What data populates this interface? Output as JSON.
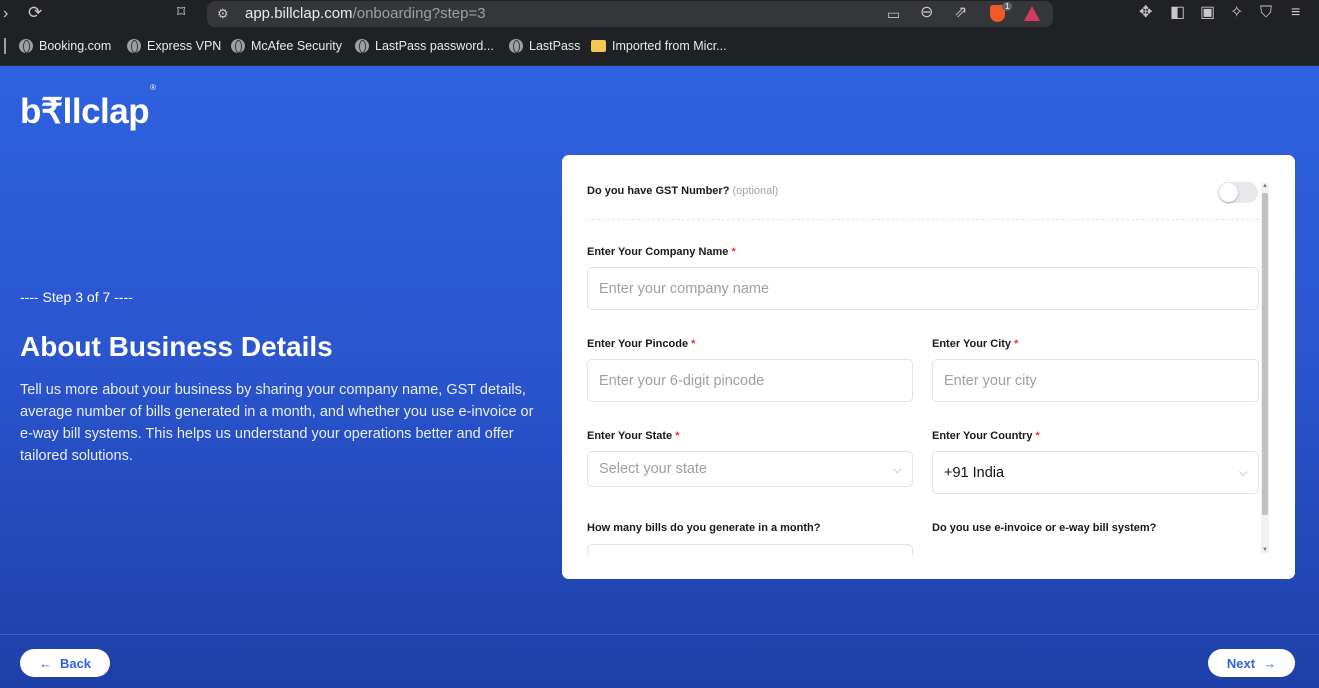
{
  "browser": {
    "url_host": "app.billclap.com",
    "url_path": "/onboarding?step=3",
    "bookmarks": [
      {
        "label": "Booking.com",
        "icon": "globe-icon"
      },
      {
        "label": "Express VPN",
        "icon": "globe-icon"
      },
      {
        "label": "McAfee Security",
        "icon": "globe-icon"
      },
      {
        "label": "LastPass password...",
        "icon": "globe-icon"
      },
      {
        "label": "LastPass",
        "icon": "globe-icon"
      },
      {
        "label": "Imported from Micr...",
        "icon": "folder-icon"
      }
    ],
    "shield_badge": "1"
  },
  "brand": {
    "logo_text": "b₹llclap",
    "registered": "®"
  },
  "left": {
    "step": "---- Step 3 of 7 ----",
    "title": "About Business Details",
    "description": "Tell us more about your business by sharing your company name, GST details, average number of bills generated in a month, and whether you use e-invoice or e-way bill systems. This helps us understand your operations better and offer tailored solutions."
  },
  "form": {
    "gst": {
      "label": "Do you have GST Number?",
      "optional": "(optional)",
      "enabled": false
    },
    "company": {
      "label": "Enter Your Company Name",
      "required": "*",
      "placeholder": "Enter your company name",
      "value": ""
    },
    "pincode": {
      "label": "Enter Your Pincode",
      "required": "*",
      "placeholder": "Enter your 6-digit pincode",
      "value": ""
    },
    "city": {
      "label": "Enter Your City",
      "required": "*",
      "placeholder": "Enter your city",
      "value": ""
    },
    "state": {
      "label": "Enter Your State",
      "required": "*",
      "placeholder": "Select your state"
    },
    "country": {
      "label": "Enter Your Country",
      "required": "*",
      "value": "+91 India"
    },
    "bills": {
      "label": "How many bills do you generate in a month?"
    },
    "einvoice": {
      "label": "Do you use e-invoice or e-way bill system?"
    }
  },
  "footer": {
    "back": "Back",
    "next": "Next"
  },
  "colors": {
    "accent": "#2f62e0",
    "required": "#e53935"
  }
}
